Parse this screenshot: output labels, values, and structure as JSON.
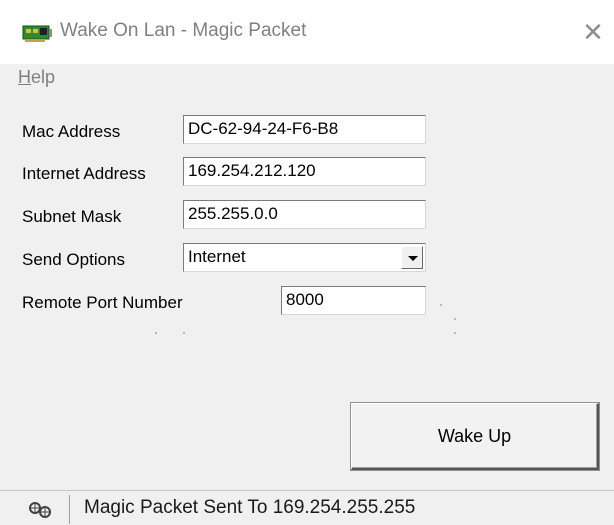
{
  "window": {
    "title": "Wake On Lan - Magic Packet",
    "close_symbol": "✕",
    "icon": "network-card-icon"
  },
  "menu": {
    "items": [
      {
        "mnemonic": "H",
        "rest": "elp"
      }
    ]
  },
  "form": {
    "mac_label": "Mac Address",
    "mac_value": "DC-62-94-24-F6-B8",
    "ip_label": "Internet Address",
    "ip_value": "169.254.212.120",
    "subnet_label": "Subnet Mask",
    "subnet_value": "255.255.0.0",
    "send_label": "Send Options",
    "send_value": "Internet",
    "port_label": "Remote Port Number",
    "port_value": "8000"
  },
  "actions": {
    "wake_label": "Wake Up"
  },
  "status": {
    "icon": "network-status-icon",
    "text": "Magic Packet Sent To 169.254.255.255"
  }
}
